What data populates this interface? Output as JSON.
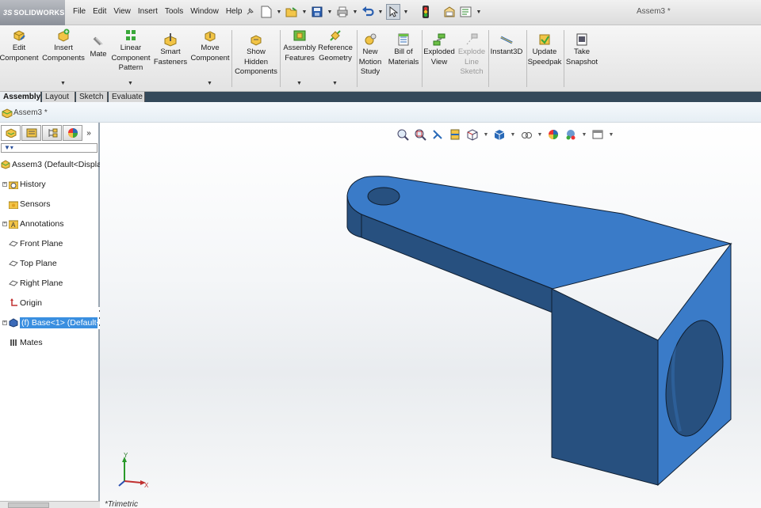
{
  "app": {
    "logo_text": "SOLIDWORKS",
    "document_title": "Assem3 *"
  },
  "menus": [
    "File",
    "Edit",
    "View",
    "Insert",
    "Tools",
    "Window",
    "Help"
  ],
  "quick_access": {
    "icons": [
      "pin-icon",
      "new-document-icon",
      "open-icon",
      "save-icon",
      "print-icon",
      "undo-icon",
      "select-icon",
      "rebuild-icon",
      "file-properties-icon",
      "options-icon"
    ]
  },
  "ribbon": {
    "commands": [
      {
        "id": "edit-component",
        "label": "Edit Component",
        "lines": [
          "Edit",
          "Component"
        ]
      },
      {
        "id": "insert-components",
        "label": "Insert Components",
        "lines": [
          "Insert",
          "Components"
        ]
      },
      {
        "id": "mate",
        "label": "Mate",
        "lines": [
          "Mate"
        ]
      },
      {
        "id": "linear-component-pattern",
        "label": "Linear Component Pattern",
        "lines": [
          "Linear",
          "Component",
          "Pattern"
        ]
      },
      {
        "id": "smart-fasteners",
        "label": "Smart Fasteners",
        "lines": [
          "Smart",
          "Fasteners"
        ]
      },
      {
        "id": "move-component",
        "label": "Move Component",
        "lines": [
          "Move",
          "Component"
        ]
      },
      {
        "id": "show-hidden-components",
        "label": "Show Hidden Components",
        "lines": [
          "Show",
          "Hidden",
          "Components"
        ]
      },
      {
        "id": "assembly-features",
        "label": "Assembly Features",
        "lines": [
          "Assembly",
          "Features"
        ]
      },
      {
        "id": "reference-geometry",
        "label": "Reference Geometry",
        "lines": [
          "Reference",
          "Geometry"
        ]
      },
      {
        "id": "new-motion-study",
        "label": "New Motion Study",
        "lines": [
          "New",
          "Motion",
          "Study"
        ]
      },
      {
        "id": "bill-of-materials",
        "label": "Bill of Materials",
        "lines": [
          "Bill of",
          "Materials"
        ]
      },
      {
        "id": "exploded-view",
        "label": "Exploded View",
        "lines": [
          "Exploded",
          "View"
        ]
      },
      {
        "id": "explode-line-sketch",
        "label": "Explode Line Sketch",
        "lines": [
          "Explode",
          "Line",
          "Sketch"
        ]
      },
      {
        "id": "instant3d",
        "label": "Instant3D",
        "lines": [
          "Instant3D"
        ]
      },
      {
        "id": "update-speedpak",
        "label": "Update Speedpak",
        "lines": [
          "Update",
          "Speedpak"
        ]
      },
      {
        "id": "take-snapshot",
        "label": "Take Snapshot",
        "lines": [
          "Take",
          "Snapshot"
        ]
      }
    ]
  },
  "tabs": [
    "Assembly",
    "Layout",
    "Sketch",
    "Evaluate"
  ],
  "active_tab": "Assembly",
  "breadcrumb": "Assem3 *",
  "feature_tree": {
    "root": "Assem3  (Default<Displa",
    "items": [
      {
        "label": "History",
        "icon": "history-folder-icon",
        "expandable": true
      },
      {
        "label": "Sensors",
        "icon": "sensors-folder-icon",
        "expandable": false
      },
      {
        "label": "Annotations",
        "icon": "annotations-icon",
        "expandable": true
      },
      {
        "label": "Front Plane",
        "icon": "plane-icon",
        "expandable": false
      },
      {
        "label": "Top Plane",
        "icon": "plane-icon",
        "expandable": false
      },
      {
        "label": "Right Plane",
        "icon": "plane-icon",
        "expandable": false
      },
      {
        "label": "Origin",
        "icon": "origin-icon",
        "expandable": false
      },
      {
        "label": "(f) Base<1> (Default<",
        "icon": "part-icon",
        "expandable": true,
        "selected": true
      },
      {
        "label": "Mates",
        "icon": "mates-icon",
        "expandable": false
      }
    ]
  },
  "view": {
    "name": "*Trimetric",
    "model_color": "#3a7bc8",
    "model_dark": "#27507f",
    "triad_labels": [
      "Y",
      "X"
    ]
  },
  "colors": {
    "selection": "#3a8fe0",
    "tab_bar": "#34495a"
  }
}
